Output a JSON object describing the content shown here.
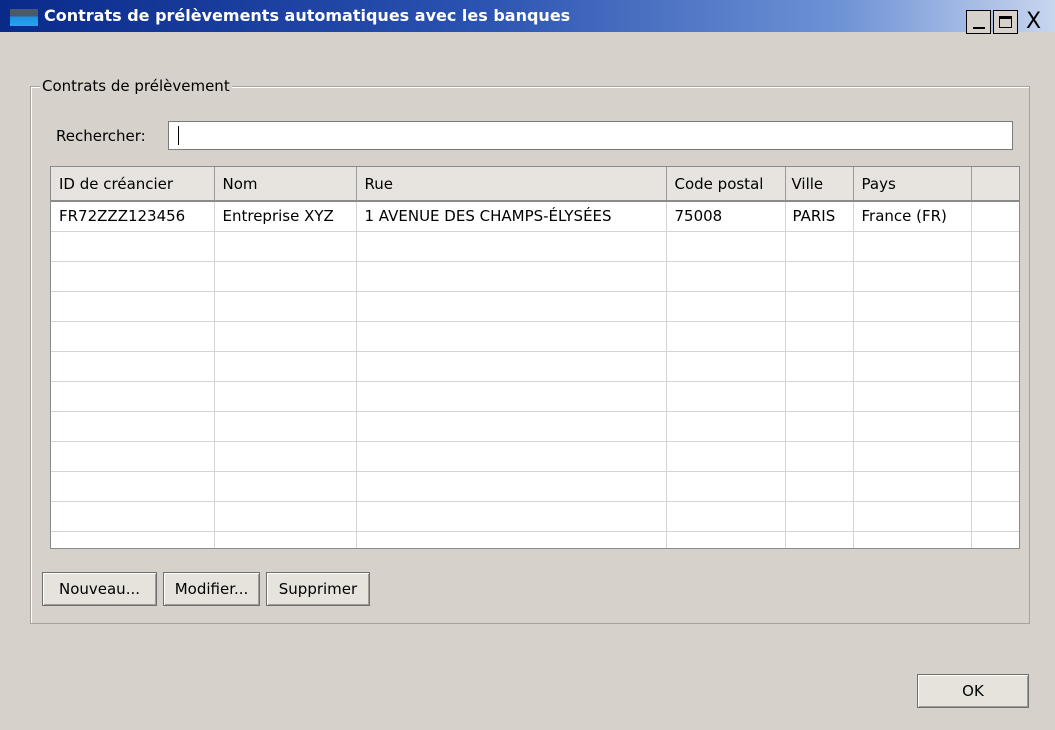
{
  "window": {
    "title": "Contrats de prélèvements automatiques avec les banques",
    "close_glyph": "X"
  },
  "group": {
    "legend": "Contrats de prélèvement"
  },
  "search": {
    "label": "Rechercher:",
    "value": ""
  },
  "table": {
    "columns": [
      "ID de créancier",
      "Nom",
      "Rue",
      "Code postal",
      "Ville",
      "Pays"
    ],
    "rows": [
      [
        "FR72ZZZ123456",
        "Entreprise XYZ",
        "1 AVENUE DES CHAMPS-ÉLYSÉES",
        "75008",
        "PARIS",
        "France (FR)"
      ]
    ]
  },
  "buttons": {
    "new_label": "Nouveau...",
    "edit_label": "Modifier...",
    "delete_label": "Supprimer",
    "ok_label": "OK"
  },
  "icons": {
    "app": "window-app-icon",
    "minimize": "minimize-icon",
    "maximize": "maximize-icon",
    "close": "close-icon"
  }
}
